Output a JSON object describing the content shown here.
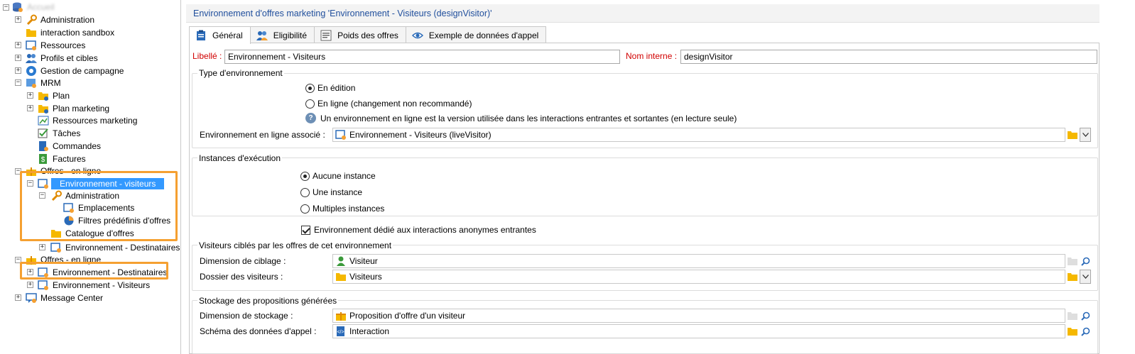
{
  "tree": {
    "root_label": "Accueil",
    "items": [
      {
        "label": "Administration"
      },
      {
        "label": "interaction sandbox"
      },
      {
        "label": "Ressources"
      },
      {
        "label": "Profils et cibles"
      },
      {
        "label": "Gestion de campagne"
      },
      {
        "label": "MRM"
      },
      {
        "label": "Plan"
      },
      {
        "label": "Plan marketing"
      },
      {
        "label": "Ressources marketing"
      },
      {
        "label": "Tâches"
      },
      {
        "label": "Commandes"
      },
      {
        "label": "Factures"
      },
      {
        "label": "Offres - en ligne"
      },
      {
        "label": "Environnement - visiteurs"
      },
      {
        "label": "Administration"
      },
      {
        "label": "Emplacements"
      },
      {
        "label": "Filtres prédéfinis d'offres"
      },
      {
        "label": "Catalogue d'offres"
      },
      {
        "label": "Environnement - Destinataires"
      },
      {
        "label": "Offres - en ligne"
      },
      {
        "label": "Environnement - Destinataires"
      },
      {
        "label": "Environnement - Visiteurs"
      },
      {
        "label": "Message Center"
      }
    ]
  },
  "title": "Environnement d'offres marketing 'Environnement - Visiteurs (designVisitor)'",
  "tabs": [
    {
      "label": "Général"
    },
    {
      "label": "Eligibilité"
    },
    {
      "label": "Poids des offres"
    },
    {
      "label": "Exemple de données d'appel"
    }
  ],
  "form": {
    "label_caption": "Libellé :",
    "label_value": "Environnement - Visiteurs",
    "internal_caption": "Nom interne :",
    "internal_value": "designVisitor",
    "env_type": {
      "title": "Type d'environnement",
      "opt1": "En édition",
      "opt2": "En ligne (changement non recommandé)",
      "info": "Un environnement en ligne est la version utilisée dans les interactions entrantes et sortantes (en lecture seule)",
      "linked_caption": "Environnement en ligne associé :",
      "linked_value": "Environnement - Visiteurs (liveVisitor)"
    },
    "instances": {
      "title": "Instances d'exécution",
      "opt1": "Aucune instance",
      "opt2": "Une instance",
      "opt3": "Multiples instances"
    },
    "anon_checkbox": "Environnement dédié aux interactions anonymes entrantes",
    "visitors": {
      "title": "Visiteurs ciblés par les offres de cet environnement",
      "dim_caption": "Dimension de ciblage :",
      "dim_value": "Visiteur",
      "folder_caption": "Dossier des visiteurs :",
      "folder_value": "Visiteurs"
    },
    "storage": {
      "title": "Stockage des propositions générées",
      "dim_caption": "Dimension de stockage :",
      "dim_value": "Proposition d'offre d'un visiteur",
      "schema_caption": "Schéma des données d'appel :",
      "schema_value": "Interaction"
    }
  },
  "colors": {
    "highlight": "#f5a031",
    "selection": "#3399ff",
    "title_text": "#1f4e9c",
    "required_label": "#d10000"
  }
}
